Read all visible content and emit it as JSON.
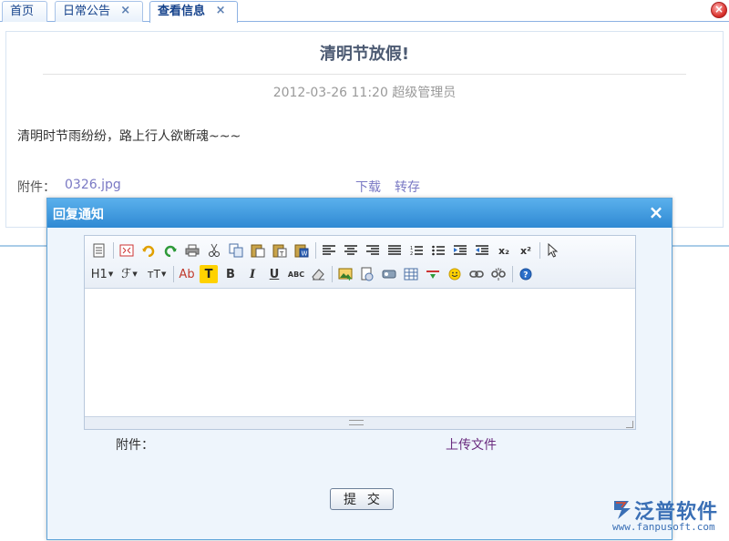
{
  "tabs": [
    {
      "label": "首页",
      "closable": false,
      "active": false
    },
    {
      "label": "日常公告",
      "closable": true,
      "active": false
    },
    {
      "label": "查看信息",
      "closable": true,
      "active": true
    }
  ],
  "icons": {
    "tab_close": "×",
    "window_close": "×",
    "dialog_close": "×"
  },
  "notice": {
    "title": "清明节放假!",
    "meta": "2012-03-26 11:20   超级管理员",
    "body": "清明时节雨纷纷，路上行人欲断魂~~~",
    "attachment_label": "附件：",
    "attachment_file": "0326.jpg",
    "download": "下载",
    "save": "转存"
  },
  "dialog": {
    "title": "回复通知",
    "attachment_label": "附件：",
    "upload": "上传文件",
    "submit": "提 交"
  },
  "toolbar": {
    "heading": "H1",
    "font": "ℱ",
    "size": "ᴛT",
    "forecolor": "Ab",
    "backcolor": "T",
    "bold": "B",
    "italic": "I",
    "underline": "U",
    "strike": "ABC",
    "sub": "x₂",
    "sup": "x²"
  },
  "logo": {
    "name": "泛普软件",
    "url": "www.fanpusoft.com"
  },
  "colors": {
    "tab_text": "#15428b",
    "dialog_header": "#2f89d3",
    "link": "#7a79c4",
    "upload_link": "#6a2b7f",
    "logo": "#3a6fb5"
  }
}
